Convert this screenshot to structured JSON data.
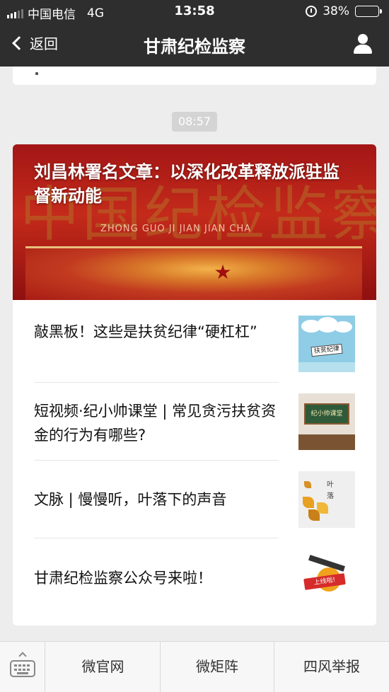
{
  "status_bar": {
    "carrier": "中国电信",
    "network": "4G",
    "time": "13:58",
    "battery_percent": "38%",
    "battery_level": 0.38,
    "battery_color": "#4cd964"
  },
  "nav": {
    "back_label": "返回",
    "title": "甘肃纪检监察",
    "profile_icon": "person-icon"
  },
  "timestamp": "08:57",
  "hero": {
    "title": "刘昌林署名文章：以深化改革释放派驻监督新动能",
    "image_calligraphy": "中国纪检监察",
    "image_pinyin": "ZHONG GUO JI JIAN JIAN CHA"
  },
  "articles": [
    {
      "title": "敲黑板！这些是扶贫纪律“硬杠杠”",
      "thumb_text": "扶贫纪律"
    },
    {
      "title": "短视频·纪小帅课堂 | 常见贪污扶贫资金的行为有哪些?",
      "thumb_text": "纪小帅课堂"
    },
    {
      "title": "文脉 | 慢慢听，叶落下的声音",
      "thumb_text": "叶落"
    },
    {
      "title": "甘肃纪检监察公众号来啦！",
      "thumb_text": "上线啦!"
    }
  ],
  "bottom_menu": {
    "keyboard_icon": "keyboard-icon",
    "items": [
      "微官网",
      "微矩阵",
      "四风举报"
    ]
  },
  "colors": {
    "nav_bg": "#2e2e2e",
    "page_bg": "#ededed",
    "hero_red": "#c42a1a"
  }
}
